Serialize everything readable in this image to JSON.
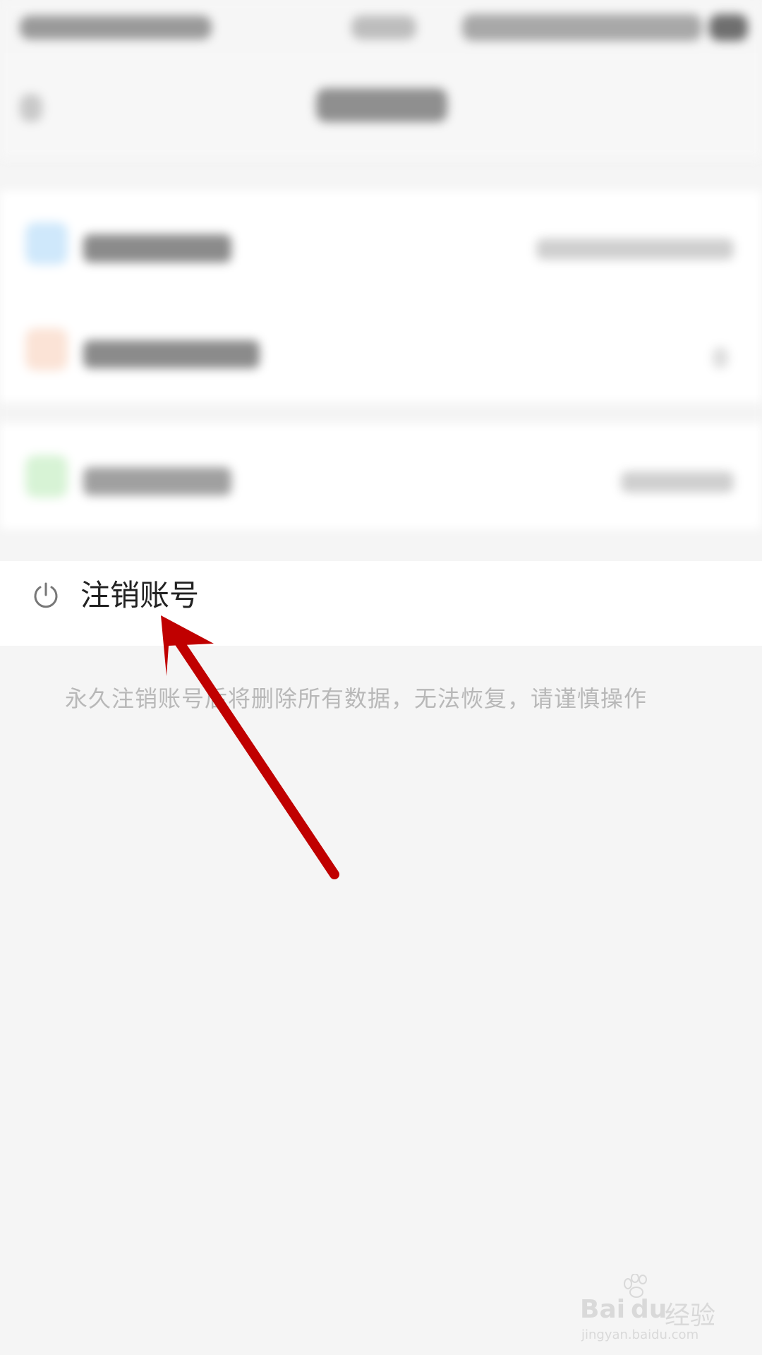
{
  "account": {
    "label": "注销账号",
    "icon": "power-icon"
  },
  "warning": {
    "text": "永久注销账号后将删除所有数据，无法恢复，请谨慎操作"
  },
  "watermark": {
    "brand": "Bai",
    "brand2": "du",
    "suffix": "经验",
    "url": "jingyan.baidu.com"
  },
  "colors": {
    "arrow": "#c00000",
    "row_bg": "#ffffff",
    "page_bg": "#f5f5f5",
    "warning_text": "#b8b8b8"
  }
}
